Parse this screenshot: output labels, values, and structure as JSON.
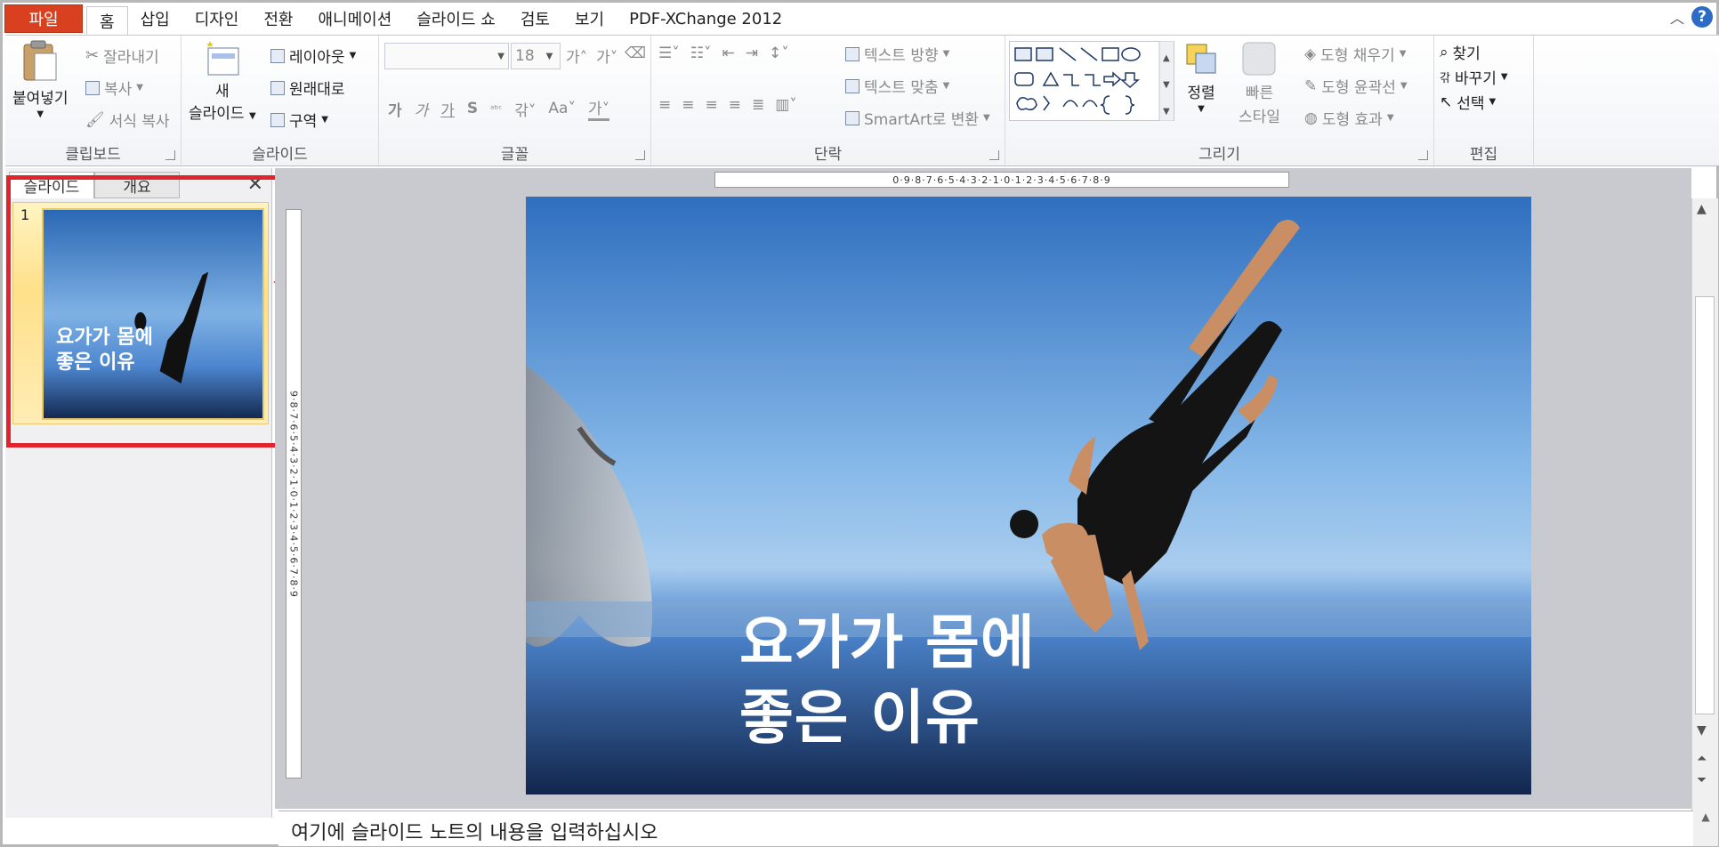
{
  "menu": {
    "file": "파일",
    "tabs": [
      "홈",
      "삽입",
      "디자인",
      "전환",
      "애니메이션",
      "슬라이드 쇼",
      "검토",
      "보기",
      "PDF-XChange 2012"
    ]
  },
  "clipboard": {
    "paste": "붙여넣기",
    "cut": "잘라내기",
    "copy": "복사",
    "format_painter": "서식 복사",
    "label": "클립보드"
  },
  "slides": {
    "new_slide_line1": "새",
    "new_slide_line2": "슬라이드",
    "layout": "레이아웃",
    "reset": "원래대로",
    "section": "구역",
    "label": "슬라이드"
  },
  "font": {
    "font_size": "18",
    "label": "글꼴"
  },
  "paragraph": {
    "text_direction": "텍스트 방향",
    "align_text": "텍스트 맞춤",
    "smartart": "SmartArt로 변환",
    "label": "단락"
  },
  "drawing": {
    "arrange": "정렬",
    "quick_styles_line1": "빠른",
    "quick_styles_line2": "스타일",
    "shape_fill": "도형 채우기",
    "shape_outline": "도형 윤곽선",
    "shape_effects": "도형 효과",
    "label": "그리기"
  },
  "editing": {
    "find": "찾기",
    "replace": "바꾸기",
    "select": "선택",
    "label": "편집"
  },
  "left_panel": {
    "tab_slides": "슬라이드",
    "tab_outline": "개요",
    "slide_number": "1"
  },
  "slide": {
    "title_line1": "요가가 몸에",
    "title_line2": "좋은 이유"
  },
  "rulers": {
    "horizontal": "0·9·8·7·6·5·4·3·2·1·0·1·2·3·4·5·6·7·8·9",
    "vertical": "9·8·7·6·5·4·3·2·1·0·1·2·3·4·5·6·7·8·9"
  },
  "notes": {
    "placeholder": "여기에 슬라이드 노트의 내용을 입력하십시오"
  },
  "colors": {
    "file_tab": "#d9401f",
    "highlight": "#e0232d",
    "sky_top": "#2b68b4",
    "sky_bottom": "#142a52"
  }
}
